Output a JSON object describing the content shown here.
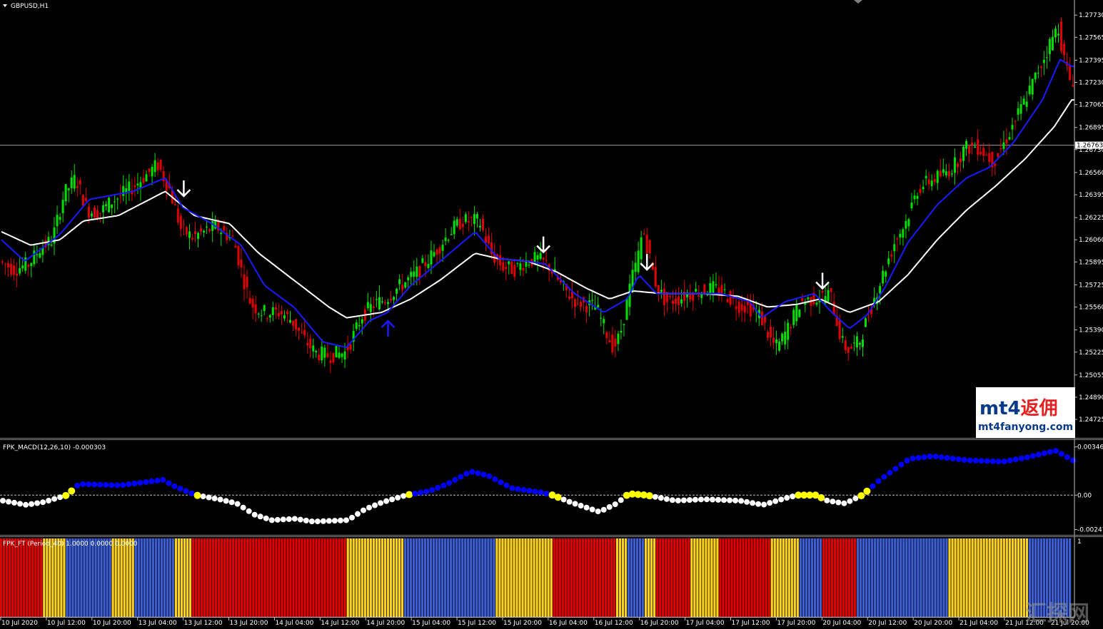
{
  "window": {
    "symbol_label": "GBPUSD,H1",
    "macd_label": "FPK_MACD(12,26,10) -0.000303",
    "ft_label": "FPK_FT (Period_40) 1.0000 0.0000 0.0000"
  },
  "colors": {
    "background": "#000000",
    "bull": "#00e000",
    "bear": "#e00000",
    "fast_ma": "#1a1aff",
    "slow_ma": "#ffffff",
    "dot_pos": "#0000ff",
    "dot_neg": "#ffffff",
    "dot_cross": "#ffff00",
    "ft_red": "#e30000",
    "ft_yellow": "#ffd21e",
    "ft_blue": "#3c5fd6"
  },
  "watermark": {
    "brand_latin": "mt4",
    "brand_cn": "返佣",
    "url": "mt4fanyong.com",
    "corner": "汇探网"
  },
  "chart_data": {
    "type": "candlestick",
    "symbol": "GBPUSD",
    "timeframe": "H1",
    "ylim": [
      1.2463,
      1.278
    ],
    "current_price": "1.26763",
    "price_ticks": [
      "1.27730",
      "1.27565",
      "1.27395",
      "1.27230",
      "1.27065",
      "1.26895",
      "1.26730",
      "1.26560",
      "1.26395",
      "1.26225",
      "1.26060",
      "1.25895",
      "1.25725",
      "1.25560",
      "1.25390",
      "1.25225",
      "1.25055",
      "1.24890",
      "1.24725"
    ],
    "time_ticks": [
      "10 Jul 2020",
      "10 Jul 12:00",
      "10 Jul 20:00",
      "13 Jul 04:00",
      "13 Jul 12:00",
      "13 Jul 20:00",
      "14 Jul 04:00",
      "14 Jul 12:00",
      "14 Jul 20:00",
      "15 Jul 04:00",
      "15 Jul 12:00",
      "15 Jul 20:00",
      "16 Jul 04:00",
      "16 Jul 12:00",
      "16 Jul 20:00",
      "17 Jul 04:00",
      "17 Jul 12:00",
      "17 Jul 20:00",
      "20 Jul 04:00",
      "20 Jul 12:00",
      "20 Jul 20:00",
      "21 Jul 04:00",
      "21 Jul 12:00",
      "21 Jul 20:00"
    ],
    "path_points": [
      [
        0,
        1.259
      ],
      [
        5,
        1.2584
      ],
      [
        10,
        1.2588
      ],
      [
        14,
        1.26
      ],
      [
        18,
        1.2606
      ],
      [
        22,
        1.264
      ],
      [
        26,
        1.2652
      ],
      [
        30,
        1.2628
      ],
      [
        34,
        1.2626
      ],
      [
        38,
        1.2634
      ],
      [
        42,
        1.264
      ],
      [
        46,
        1.2646
      ],
      [
        50,
        1.2654
      ],
      [
        54,
        1.2662
      ],
      [
        58,
        1.2644
      ],
      [
        62,
        1.2614
      ],
      [
        66,
        1.2608
      ],
      [
        70,
        1.2612
      ],
      [
        74,
        1.2616
      ],
      [
        80,
        1.2606
      ],
      [
        84,
        1.2572
      ],
      [
        86,
        1.2558
      ],
      [
        90,
        1.2552
      ],
      [
        96,
        1.2552
      ],
      [
        100,
        1.2546
      ],
      [
        104,
        1.2532
      ],
      [
        108,
        1.2522
      ],
      [
        112,
        1.252
      ],
      [
        118,
        1.2522
      ],
      [
        120,
        1.253
      ],
      [
        124,
        1.255
      ],
      [
        128,
        1.2558
      ],
      [
        132,
        1.2562
      ],
      [
        136,
        1.257
      ],
      [
        142,
        1.258
      ],
      [
        146,
        1.259
      ],
      [
        150,
        1.26
      ],
      [
        154,
        1.2612
      ],
      [
        158,
        1.262
      ],
      [
        164,
        1.262
      ],
      [
        168,
        1.2596
      ],
      [
        172,
        1.2586
      ],
      [
        176,
        1.2584
      ],
      [
        180,
        1.259
      ],
      [
        184,
        1.2592
      ],
      [
        188,
        1.2586
      ],
      [
        192,
        1.2572
      ],
      [
        196,
        1.2562
      ],
      [
        200,
        1.2558
      ],
      [
        204,
        1.2556
      ],
      [
        208,
        1.2534
      ],
      [
        210,
        1.2526
      ],
      [
        212,
        1.2534
      ],
      [
        214,
        1.2554
      ],
      [
        216,
        1.2576
      ],
      [
        218,
        1.259
      ],
      [
        220,
        1.2614
      ],
      [
        222,
        1.2596
      ],
      [
        224,
        1.2576
      ],
      [
        226,
        1.2566
      ],
      [
        228,
        1.256
      ],
      [
        232,
        1.2562
      ],
      [
        236,
        1.2566
      ],
      [
        240,
        1.2568
      ],
      [
        244,
        1.257
      ],
      [
        248,
        1.2566
      ],
      [
        252,
        1.2558
      ],
      [
        256,
        1.2556
      ],
      [
        260,
        1.255
      ],
      [
        264,
        1.253
      ],
      [
        266,
        1.2526
      ],
      [
        270,
        1.2542
      ],
      [
        274,
        1.256
      ],
      [
        278,
        1.2562
      ],
      [
        282,
        1.2564
      ],
      [
        284,
        1.2566
      ],
      [
        286,
        1.2548
      ],
      [
        288,
        1.253
      ],
      [
        290,
        1.2524
      ],
      [
        294,
        1.253
      ],
      [
        298,
        1.2556
      ],
      [
        302,
        1.258
      ],
      [
        306,
        1.2604
      ],
      [
        310,
        1.262
      ],
      [
        314,
        1.2644
      ],
      [
        318,
        1.265
      ],
      [
        322,
        1.2654
      ],
      [
        326,
        1.266
      ],
      [
        330,
        1.2674
      ],
      [
        334,
        1.2676
      ],
      [
        338,
        1.2668
      ],
      [
        340,
        1.2664
      ],
      [
        344,
        1.268
      ],
      [
        348,
        1.2698
      ],
      [
        352,
        1.2716
      ],
      [
        356,
        1.2736
      ],
      [
        360,
        1.2756
      ],
      [
        362,
        1.2765
      ],
      [
        364,
        1.274
      ],
      [
        366,
        1.2725
      ]
    ],
    "fast_ma_points": [
      [
        0,
        1.2606
      ],
      [
        8,
        1.259
      ],
      [
        20,
        1.261
      ],
      [
        30,
        1.2636
      ],
      [
        45,
        1.2642
      ],
      [
        56,
        1.2652
      ],
      [
        62,
        1.263
      ],
      [
        72,
        1.2618
      ],
      [
        82,
        1.2602
      ],
      [
        90,
        1.2572
      ],
      [
        100,
        1.2556
      ],
      [
        110,
        1.253
      ],
      [
        118,
        1.2526
      ],
      [
        126,
        1.2546
      ],
      [
        132,
        1.2552
      ],
      [
        140,
        1.2572
      ],
      [
        150,
        1.259
      ],
      [
        162,
        1.2612
      ],
      [
        170,
        1.2592
      ],
      [
        180,
        1.259
      ],
      [
        186,
        1.2588
      ],
      [
        196,
        1.2566
      ],
      [
        206,
        1.2552
      ],
      [
        214,
        1.2562
      ],
      [
        218,
        1.258
      ],
      [
        224,
        1.2566
      ],
      [
        236,
        1.2566
      ],
      [
        246,
        1.2566
      ],
      [
        256,
        1.256
      ],
      [
        260,
        1.2548
      ],
      [
        268,
        1.256
      ],
      [
        278,
        1.2566
      ],
      [
        284,
        1.2552
      ],
      [
        290,
        1.254
      ],
      [
        296,
        1.255
      ],
      [
        302,
        1.257
      ],
      [
        310,
        1.2604
      ],
      [
        320,
        1.2632
      ],
      [
        330,
        1.2652
      ],
      [
        338,
        1.266
      ],
      [
        346,
        1.2678
      ],
      [
        356,
        1.271
      ],
      [
        362,
        1.274
      ],
      [
        366,
        1.2735
      ]
    ],
    "slow_ma_points": [
      [
        0,
        1.2612
      ],
      [
        10,
        1.2602
      ],
      [
        20,
        1.2606
      ],
      [
        28,
        1.262
      ],
      [
        40,
        1.2624
      ],
      [
        56,
        1.2642
      ],
      [
        66,
        1.2624
      ],
      [
        78,
        1.2618
      ],
      [
        88,
        1.2596
      ],
      [
        100,
        1.2576
      ],
      [
        112,
        1.2556
      ],
      [
        118,
        1.2548
      ],
      [
        130,
        1.2552
      ],
      [
        140,
        1.2562
      ],
      [
        150,
        1.2576
      ],
      [
        162,
        1.2596
      ],
      [
        170,
        1.2592
      ],
      [
        180,
        1.259
      ],
      [
        190,
        1.2582
      ],
      [
        200,
        1.257
      ],
      [
        208,
        1.2562
      ],
      [
        216,
        1.2568
      ],
      [
        226,
        1.2566
      ],
      [
        240,
        1.2566
      ],
      [
        252,
        1.2564
      ],
      [
        262,
        1.2556
      ],
      [
        272,
        1.2558
      ],
      [
        280,
        1.2562
      ],
      [
        290,
        1.2552
      ],
      [
        300,
        1.256
      ],
      [
        310,
        1.258
      ],
      [
        320,
        1.2606
      ],
      [
        330,
        1.2628
      ],
      [
        340,
        1.2646
      ],
      [
        350,
        1.2666
      ],
      [
        360,
        1.269
      ],
      [
        366,
        1.271
      ]
    ],
    "signal_arrows": [
      {
        "bar": 62,
        "dir": "down"
      },
      {
        "bar": 132,
        "dir": "up"
      },
      {
        "bar": 185,
        "dir": "down"
      },
      {
        "bar": 220,
        "dir": "down"
      },
      {
        "bar": 280,
        "dir": "down"
      }
    ],
    "macd": {
      "label": "FPK_MACD(12,26,10)",
      "last_value": -0.000303,
      "ylim": [
        -0.0026,
        0.0036
      ],
      "ticks": [
        "0.003464",
        "0.00",
        "-0.002474"
      ],
      "dots": [
        [
          0,
          -0.0004
        ],
        [
          8,
          -0.0007
        ],
        [
          14,
          -0.0005
        ],
        [
          22,
          0.0
        ],
        [
          26,
          0.0008
        ],
        [
          40,
          0.0007
        ],
        [
          55,
          0.0011
        ],
        [
          58,
          0.0007
        ],
        [
          66,
          0.0
        ],
        [
          74,
          -0.0003
        ],
        [
          80,
          -0.0006
        ],
        [
          86,
          -0.0014
        ],
        [
          92,
          -0.0018
        ],
        [
          100,
          -0.0017
        ],
        [
          106,
          -0.0019
        ],
        [
          118,
          -0.0018
        ],
        [
          124,
          -0.001
        ],
        [
          130,
          -0.0005
        ],
        [
          138,
          0.0
        ],
        [
          146,
          0.0003
        ],
        [
          152,
          0.0008
        ],
        [
          160,
          0.0017
        ],
        [
          166,
          0.0014
        ],
        [
          174,
          0.0005
        ],
        [
          184,
          0.0002
        ],
        [
          188,
          0.0
        ],
        [
          194,
          -0.0005
        ],
        [
          204,
          -0.0012
        ],
        [
          210,
          -0.0006
        ],
        [
          214,
          0.0001
        ],
        [
          220,
          0.0
        ],
        [
          230,
          -0.0004
        ],
        [
          240,
          -0.0003
        ],
        [
          252,
          -0.0004
        ],
        [
          260,
          -0.0007
        ],
        [
          268,
          -0.0002
        ],
        [
          272,
          0.0
        ],
        [
          278,
          0.0
        ],
        [
          282,
          -0.0004
        ],
        [
          288,
          -0.0006
        ],
        [
          294,
          0.0
        ],
        [
          300,
          0.0011
        ],
        [
          310,
          0.0026
        ],
        [
          318,
          0.0028
        ],
        [
          330,
          0.0025
        ],
        [
          342,
          0.0024
        ],
        [
          350,
          0.0027
        ],
        [
          360,
          0.0032
        ],
        [
          366,
          0.0025
        ]
      ]
    },
    "ft": {
      "label": "FPK_FT (Period_40)",
      "values": [
        1.0,
        0.0,
        0.0
      ],
      "ylim": [
        0,
        1
      ],
      "ticks": [
        "1"
      ],
      "segments": [
        [
          "red",
          0,
          15
        ],
        [
          "yellow",
          15,
          23
        ],
        [
          "blue",
          23,
          39
        ],
        [
          "yellow",
          39,
          47
        ],
        [
          "blue",
          47,
          61
        ],
        [
          "yellow",
          61,
          67
        ],
        [
          "red",
          67,
          121
        ],
        [
          "yellow",
          121,
          141
        ],
        [
          "blue",
          141,
          173
        ],
        [
          "yellow",
          173,
          193
        ],
        [
          "red",
          193,
          215
        ],
        [
          "yellow",
          215,
          219
        ],
        [
          "blue",
          219,
          225
        ],
        [
          "yellow",
          225,
          229
        ],
        [
          "red",
          229,
          241
        ],
        [
          "yellow",
          241,
          251
        ],
        [
          "red",
          251,
          269
        ],
        [
          "yellow",
          269,
          279
        ],
        [
          "blue",
          279,
          287
        ],
        [
          "red",
          287,
          299
        ],
        [
          "blue",
          299,
          331
        ],
        [
          "yellow",
          331,
          359
        ],
        [
          "blue",
          359,
          374
        ]
      ]
    }
  }
}
